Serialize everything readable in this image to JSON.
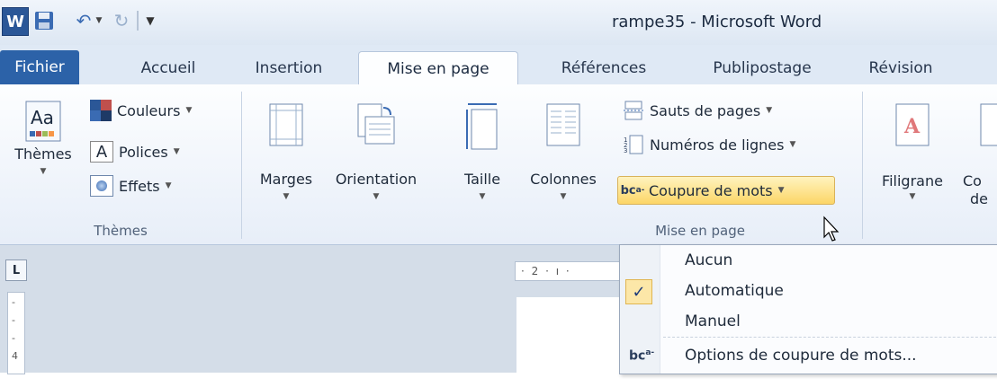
{
  "window": {
    "title": "rampe35 - Microsoft Word"
  },
  "qat": {
    "logo": "W",
    "icons": [
      "word-icon",
      "save-icon",
      "undo-icon",
      "redo-icon",
      "customize-icon"
    ]
  },
  "tabs": [
    {
      "label": "Fichier"
    },
    {
      "label": "Accueil"
    },
    {
      "label": "Insertion"
    },
    {
      "label": "Mise en page"
    },
    {
      "label": "Références"
    },
    {
      "label": "Publipostage"
    },
    {
      "label": "Révision"
    }
  ],
  "ribbon": {
    "themes": {
      "group_label": "Thèmes",
      "themes_button": "Thèmes",
      "colors_button": "Couleurs",
      "fonts_button": "Polices",
      "effects_button": "Effets"
    },
    "page_setup": {
      "group_label": "Mise en page",
      "margins": "Marges",
      "orientation": "Orientation",
      "size": "Taille",
      "columns": "Colonnes",
      "breaks": "Sauts de pages",
      "line_numbers": "Numéros de lignes",
      "hyphenation": "Coupure de mots"
    },
    "background": {
      "watermark": "Filigrane",
      "partial_top": "Co",
      "partial_bottom": "de"
    }
  },
  "ruler": {
    "corner": "L",
    "horizontal": "· 2 · ı ·",
    "vertical": [
      "-",
      "-",
      "-",
      "4"
    ]
  },
  "menu": {
    "items": [
      {
        "label": "Aucun",
        "checked": false
      },
      {
        "label": "Automatique",
        "checked": true
      },
      {
        "label": "Manuel",
        "checked": false
      },
      {
        "label": "Options de coupure de mots...",
        "checked": false
      }
    ],
    "hyphen_icon_text": "bc"
  },
  "colors": {
    "accent": "#2c62a8",
    "highlight": "#fcd667",
    "ribbon_bg": "#e7eef8"
  }
}
